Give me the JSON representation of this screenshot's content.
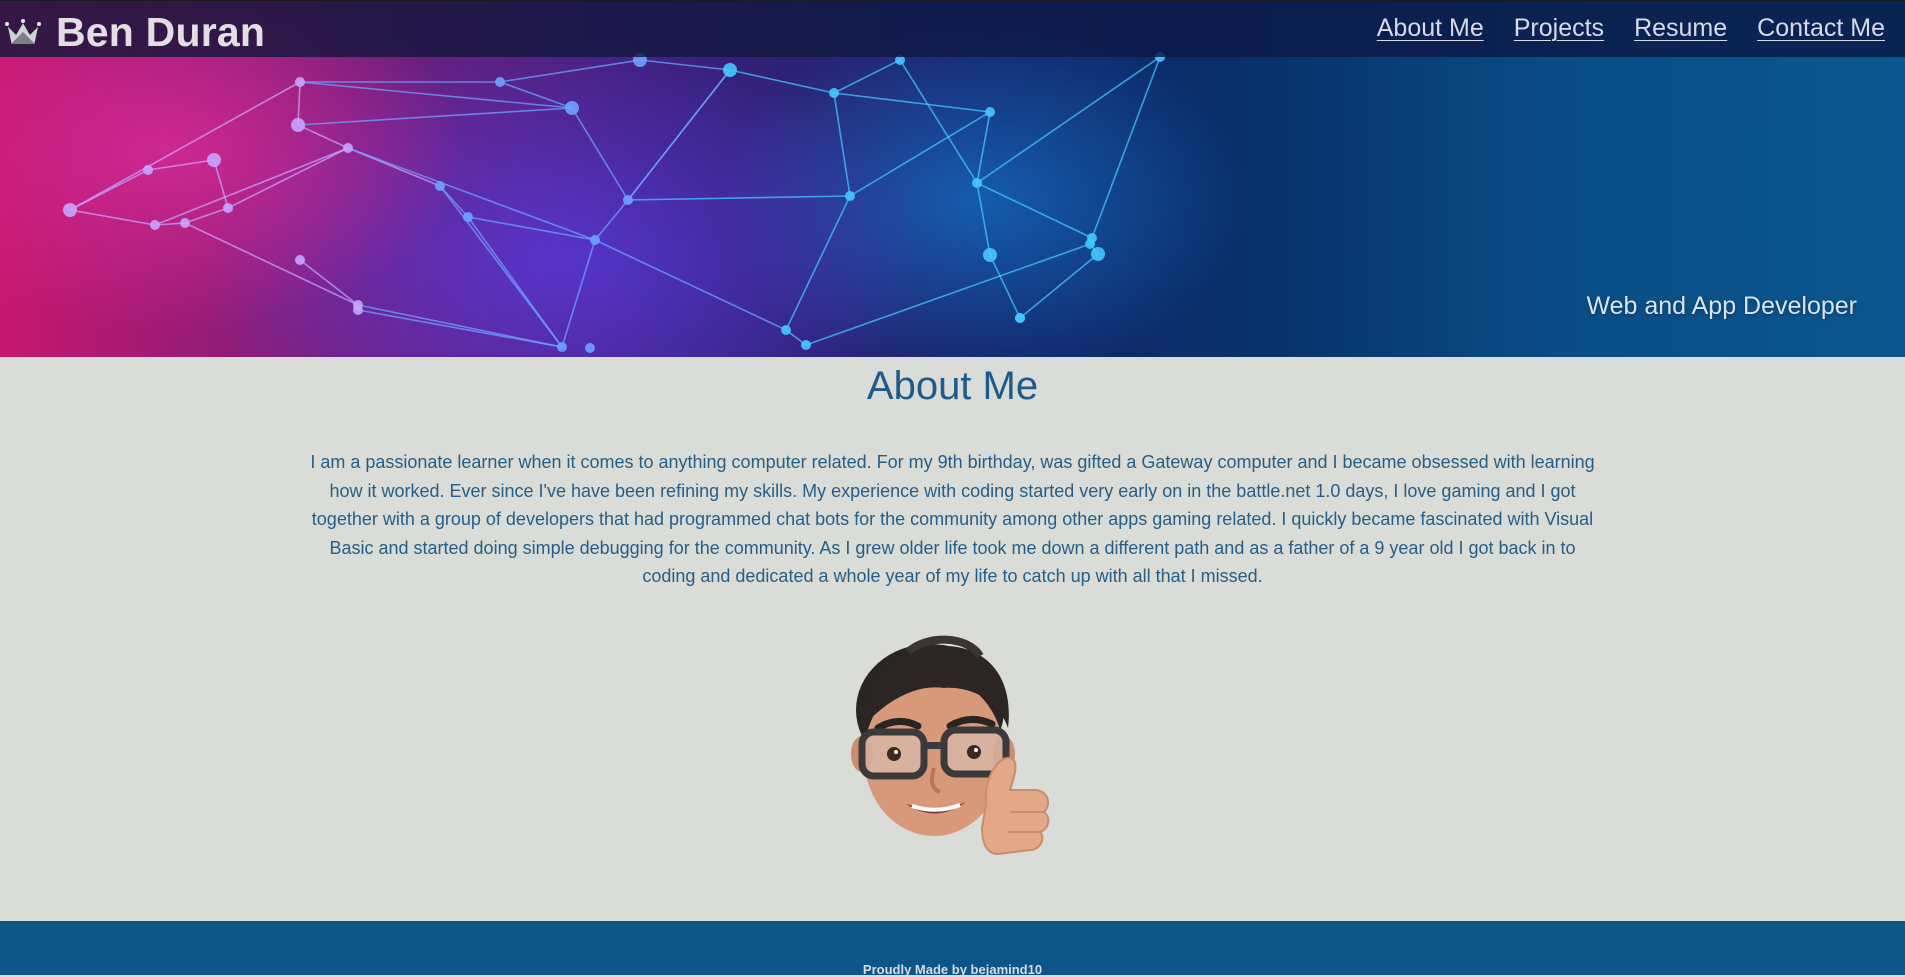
{
  "header": {
    "brand_name": "Ben Duran",
    "logo_icon": "crown-icon",
    "nav": [
      {
        "label": "About Me"
      },
      {
        "label": "Projects"
      },
      {
        "label": "Resume"
      },
      {
        "label": "Contact Me"
      }
    ]
  },
  "hero": {
    "tagline": "Web and App Developer",
    "background": "network-graph-gradient"
  },
  "about": {
    "title": "About Me",
    "body": "I am a passionate learner when it comes to anything computer related. For my 9th birthday, was gifted a Gateway computer and I became obsessed with learning how it worked. Ever since I've have been refining my skills. My experience with coding started very early on in the battle.net 1.0 days, I love gaming and I got together with a group of developers that had programmed chat bots for the community among other apps gaming related. I quickly became fascinated with Visual Basic and started doing simple debugging for the community. As I grew older life took me down a different path and as a father of a 9 year old I got back in to coding and dedicated a whole year of my life to catch up with all that I missed.",
    "avatar": "memoji-thumbs-up"
  },
  "footer": {
    "text": "Proudly Made by bejamind10"
  },
  "colors": {
    "page_bg": "#d9dcd7",
    "heading": "#1d5b8a",
    "body_text": "#275e87",
    "footer_bg": "#0d5586",
    "nav_text": "#d8dbe6"
  }
}
